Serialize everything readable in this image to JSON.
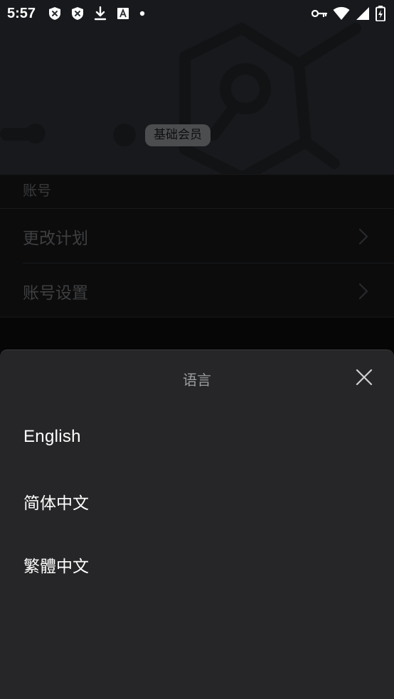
{
  "status_bar": {
    "time": "5:57",
    "left_icons": [
      "shield-x-icon",
      "shield-x-icon",
      "download-icon",
      "font-icon",
      "dot-icon"
    ],
    "right_icons": [
      "key-icon",
      "wifi-icon",
      "signal-icon",
      "battery-charging-icon"
    ]
  },
  "header": {
    "member_badge": "基础会员"
  },
  "account": {
    "section_title": "账号",
    "items": [
      {
        "label": "更改计划"
      },
      {
        "label": "账号设置"
      }
    ]
  },
  "language_sheet": {
    "title": "语言",
    "options": [
      {
        "label": "English"
      },
      {
        "label": "简体中文"
      },
      {
        "label": "繁體中文"
      }
    ]
  },
  "colors": {
    "sheet_background": "#262628",
    "header_background": "#2a2f33",
    "badge_background": "#8a8d90"
  }
}
